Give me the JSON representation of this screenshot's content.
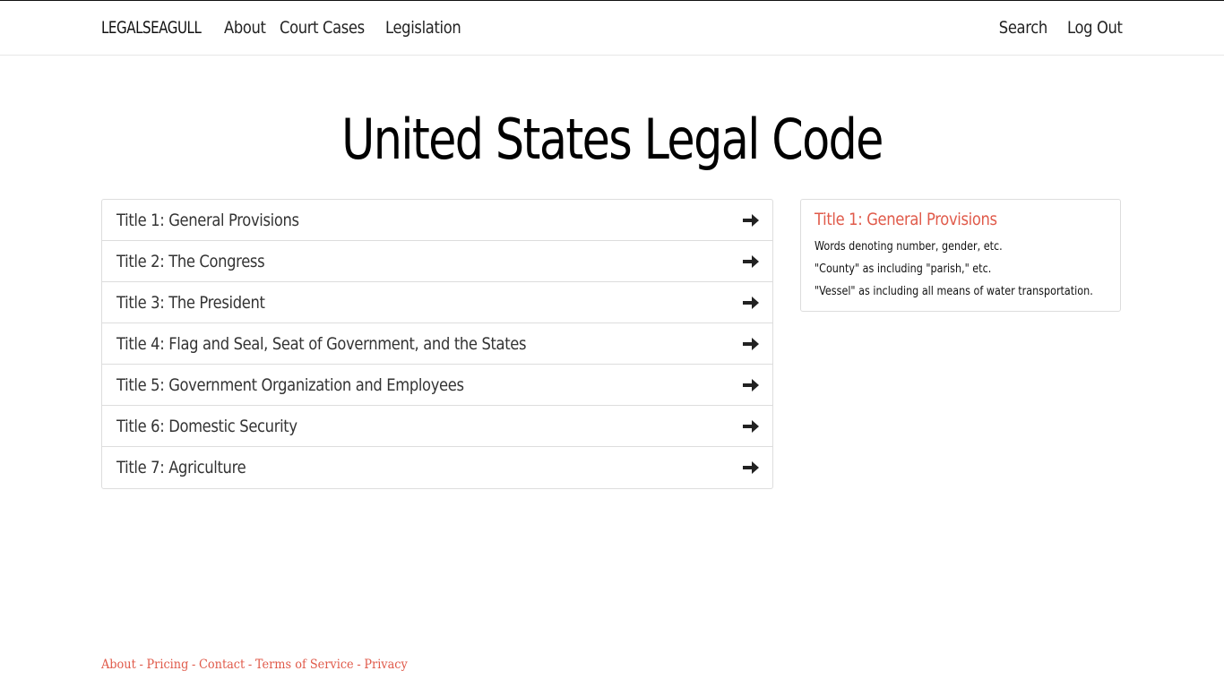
{
  "navbar": {
    "brand": "LEGALSEAGULL",
    "left_links": [
      "About",
      "Court Cases",
      "Legislation"
    ],
    "right_links": [
      "Search",
      "Log Out"
    ]
  },
  "page_title": "United States Legal Code",
  "titles": [
    {
      "label": "Title 1: General Provisions",
      "icon": "arrow-right-icon"
    },
    {
      "label": "Title 2: The Congress",
      "icon": "arrow-right-icon"
    },
    {
      "label": "Title 3: The President",
      "icon": "arrow-right-icon"
    },
    {
      "label": "Title 4: Flag and Seal, Seat of Government, and the States",
      "icon": "arrow-right-icon"
    },
    {
      "label": "Title 5: Government Organization and Employees",
      "icon": "arrow-right-icon"
    },
    {
      "label": "Title 6: Domestic Security",
      "icon": "arrow-right-icon"
    },
    {
      "label": "Title 7: Agriculture",
      "icon": "arrow-right-icon"
    }
  ],
  "side_panel": {
    "title": "Title 1: General Provisions",
    "items": [
      "Words denoting number, gender, etc.",
      "\"County\" as including \"parish,\" etc.",
      "\"Vessel\" as including all means of water transportation."
    ]
  },
  "footer": {
    "links": [
      "About",
      "Pricing",
      "Contact",
      "Terms of Service",
      "Privacy"
    ],
    "separator": "-"
  },
  "colors": {
    "accent": "#e05a4a",
    "text": "#333333",
    "border": "#dddddd"
  }
}
